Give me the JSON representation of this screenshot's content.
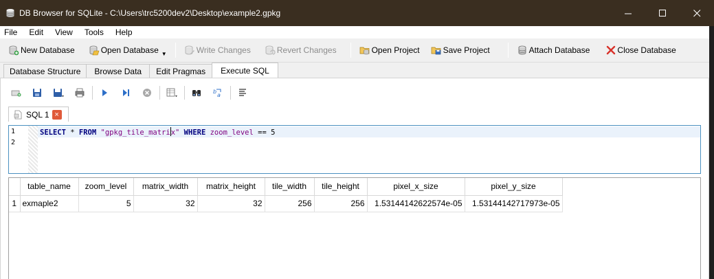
{
  "window": {
    "title": "DB Browser for SQLite - C:\\Users\\trc5200dev2\\Desktop\\example2.gpkg",
    "icons": [
      "database-icon",
      "minimize-icon",
      "maximize-icon",
      "close-icon"
    ]
  },
  "menu": {
    "items": [
      "File",
      "Edit",
      "View",
      "Tools",
      "Help"
    ]
  },
  "toolbar": {
    "new_database": "New Database",
    "open_database": "Open Database",
    "write_changes": "Write Changes",
    "revert_changes": "Revert Changes",
    "open_project": "Open Project",
    "save_project": "Save Project",
    "attach_database": "Attach Database",
    "close_database": "Close Database"
  },
  "tabs": {
    "items": [
      "Database Structure",
      "Browse Data",
      "Edit Pragmas",
      "Execute SQL"
    ],
    "active": "Execute SQL"
  },
  "sql_tab": {
    "label": "SQL 1",
    "close": "×"
  },
  "editor": {
    "line_numbers": [
      "1",
      "2"
    ],
    "tokens": {
      "select": "SELECT",
      "star": " * ",
      "from": "FROM",
      "sp1": " ",
      "table_str_before": "\"gpkg_tile_matri",
      "table_str_after": "x\"",
      "sp2": " ",
      "where": "WHERE",
      "sp3": " ",
      "column": "zoom_level",
      "op": " == ",
      "value": "5"
    }
  },
  "results": {
    "columns": [
      "table_name",
      "zoom_level",
      "matrix_width",
      "matrix_height",
      "tile_width",
      "tile_height",
      "pixel_x_size",
      "pixel_y_size"
    ],
    "rows": [
      {
        "row_number": "1",
        "cells": [
          "exmaple2",
          "5",
          "32",
          "32",
          "256",
          "256",
          "1.53144142622574e-05",
          "1.53144142717973e-05"
        ]
      }
    ]
  }
}
